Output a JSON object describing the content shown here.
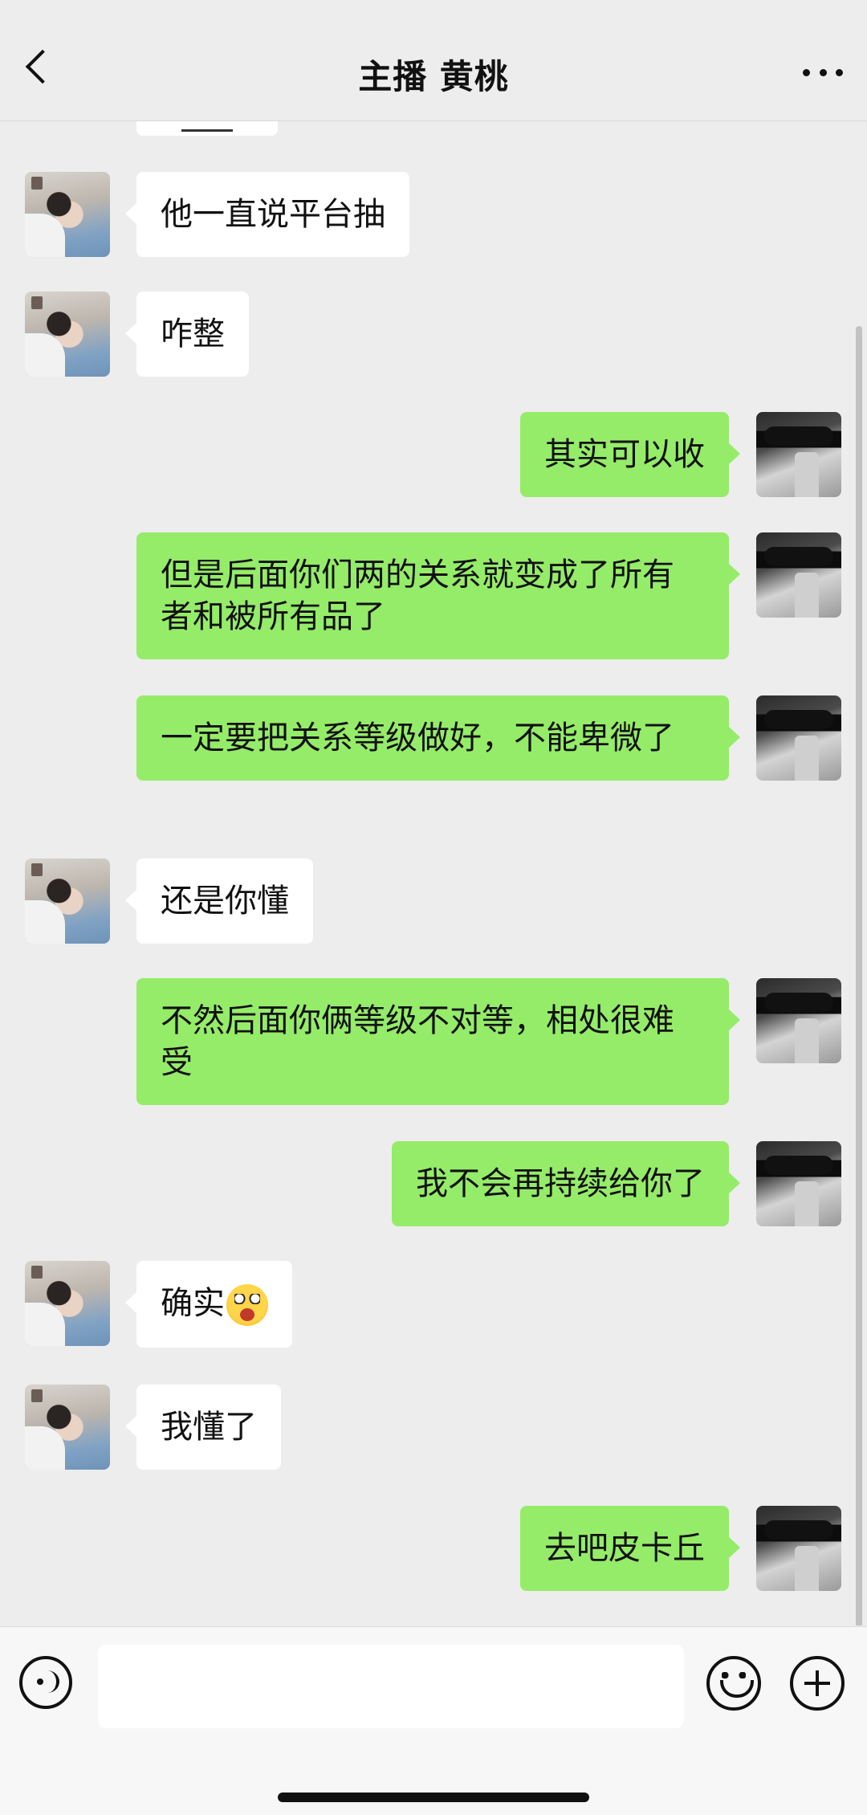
{
  "header": {
    "title": "主播 黄桃"
  },
  "messages": [
    {
      "side": "in",
      "text": "他一直说平台抽"
    },
    {
      "side": "in",
      "text": "咋整"
    },
    {
      "side": "out",
      "text": "其实可以收"
    },
    {
      "side": "out",
      "text": "但是后面你们两的关系就变成了所有者和被所有品了"
    },
    {
      "side": "out",
      "text": "一定要把关系等级做好，不能卑微了"
    },
    {
      "side": "in",
      "text": "还是你懂"
    },
    {
      "side": "out",
      "text": "不然后面你俩等级不对等，相处很难受"
    },
    {
      "side": "out",
      "text": "我不会再持续给你了"
    },
    {
      "side": "in",
      "text": "确实",
      "emoji": "surprised-face-emoji"
    },
    {
      "side": "in",
      "text": "我懂了"
    },
    {
      "side": "out",
      "text": "去吧皮卡丘"
    }
  ],
  "input": {
    "value": ""
  },
  "colors": {
    "outgoing_bubble": "#95ec69",
    "incoming_bubble": "#ffffff",
    "background": "#ededed"
  }
}
